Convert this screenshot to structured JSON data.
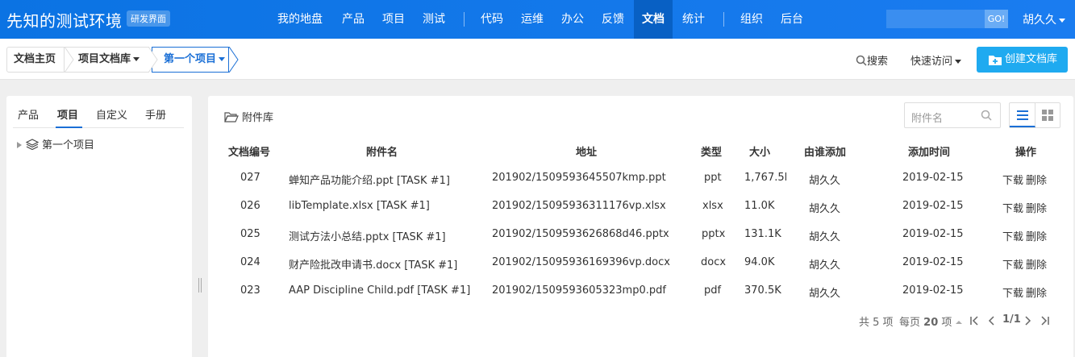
{
  "app": {
    "brand": "先知的测试环境",
    "badge": "研发界面",
    "go_label": "GO!",
    "user": "胡久久"
  },
  "nav": [
    {
      "label": "我的地盘"
    },
    {
      "label": "产品"
    },
    {
      "label": "项目"
    },
    {
      "label": "测试"
    },
    {
      "label": "代码"
    },
    {
      "label": "运维"
    },
    {
      "label": "办公"
    },
    {
      "label": "反馈"
    },
    {
      "label": "文档",
      "active": true
    },
    {
      "label": "统计"
    },
    {
      "label": "组织"
    },
    {
      "label": "后台"
    }
  ],
  "breadcrumb": {
    "home": "文档主页",
    "library": "项目文档库",
    "current": "第一个项目"
  },
  "toolbar": {
    "search": "搜索",
    "quick_access": "快速访问",
    "create": "创建文档库"
  },
  "sidebar": {
    "tabs": [
      "产品",
      "项目",
      "自定义",
      "手册"
    ],
    "active_tab": "项目",
    "tree": [
      "第一个项目"
    ]
  },
  "main": {
    "title": "附件库",
    "search_placeholder": "附件名",
    "columns": [
      "文档编号",
      "附件名",
      "地址",
      "类型",
      "大小",
      "由谁添加",
      "添加时间",
      "操作"
    ],
    "rows": [
      {
        "id": "027",
        "name": "蝉知产品功能介绍.ppt [TASK #1]",
        "path": "201902/1509593645507kmp.ppt",
        "type": "ppt",
        "size": "1,767.5K",
        "by": "胡久久",
        "date": "2019-02-15"
      },
      {
        "id": "026",
        "name": "libTemplate.xlsx [TASK #1]",
        "path": "201902/1509593631117​6vp.xlsx",
        "type": "xlsx",
        "size": "11.0K",
        "by": "胡久久",
        "date": "2019-02-15"
      },
      {
        "id": "025",
        "name": "测试方法小总结.pptx [TASK #1]",
        "path": "201902/1509593626868d46.pptx",
        "type": "pptx",
        "size": "131.1K",
        "by": "胡久久",
        "date": "2019-02-15"
      },
      {
        "id": "024",
        "name": "财产险批改申请书.docx [TASK #1]",
        "path": "201902/1509593616939​6vp.docx",
        "type": "docx",
        "size": "94.0K",
        "by": "胡久久",
        "date": "2019-02-15"
      },
      {
        "id": "023",
        "name": "AAP Discipline Child.pdf [TASK #1]",
        "path": "201902/1509593605323mp0.pdf",
        "type": "pdf",
        "size": "370.5K",
        "by": "胡久久",
        "date": "2019-02-15"
      }
    ],
    "actions": {
      "download": "下载",
      "delete": "删除"
    },
    "pager": {
      "total": "共 5 项",
      "per_page_label": "每页",
      "per_page": "20",
      "unit": "项",
      "page": "1/1"
    }
  },
  "colors": {
    "topbar": "#0b73e3",
    "accent": "#1a6fd6",
    "create_button": "#1faaf0"
  }
}
